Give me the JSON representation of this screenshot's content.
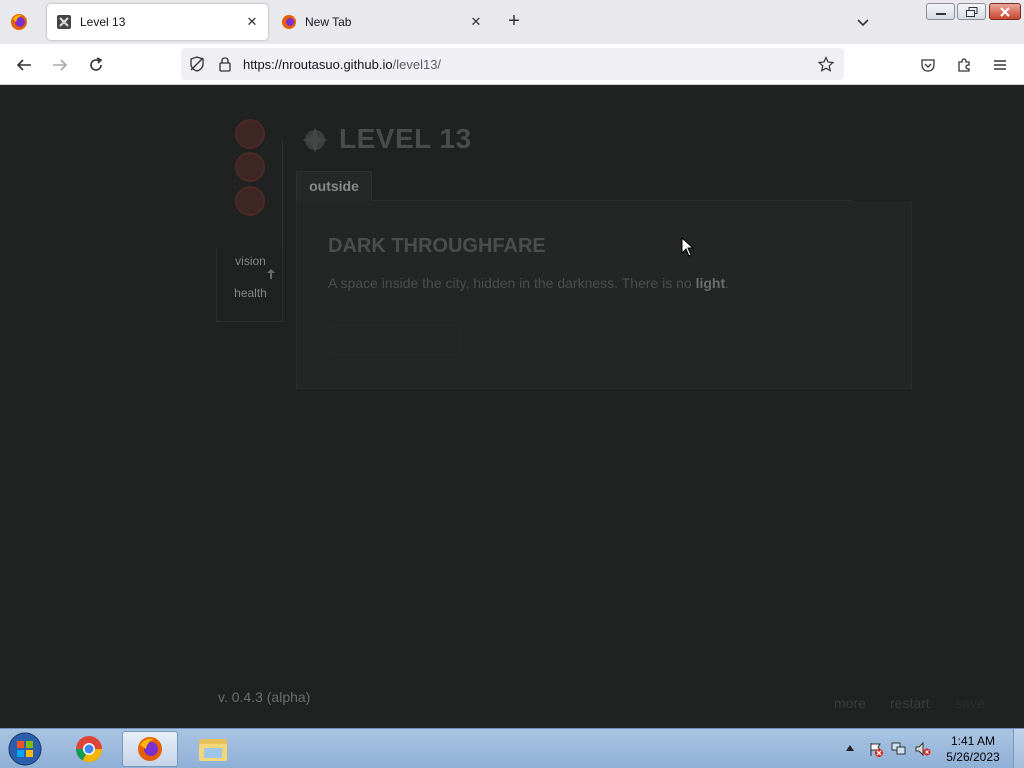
{
  "browser": {
    "tabs": [
      {
        "title": "Level 13",
        "active": true
      },
      {
        "title": "New Tab",
        "active": false
      }
    ],
    "url": {
      "host": "https://nroutasuo.github.io",
      "path": "/level13/"
    }
  },
  "game": {
    "log": [
      "",
      "",
      "",
      "",
      "",
      "",
      ""
    ],
    "stats": {
      "vision_label": "vision",
      "vision_value": "",
      "health_label": "health",
      "health_value": ""
    },
    "title": "LEVEL 13",
    "tab_label": "outside",
    "location_title": "DARK THROUGHFARE",
    "location_desc": "A space inside the city, hidden in the darkness. There is no ",
    "location_desc_bold": "light",
    "location_desc_end": ".",
    "action_button": "",
    "version": "v. 0.4.3 (alpha)",
    "footer": {
      "more": "more",
      "restart": "restart",
      "save": "save"
    }
  },
  "taskbar": {
    "time": "1:41 AM",
    "date": "5/26/2023"
  },
  "colors": {
    "page_bg": "#202221",
    "stat_circle": "#3d2624"
  }
}
